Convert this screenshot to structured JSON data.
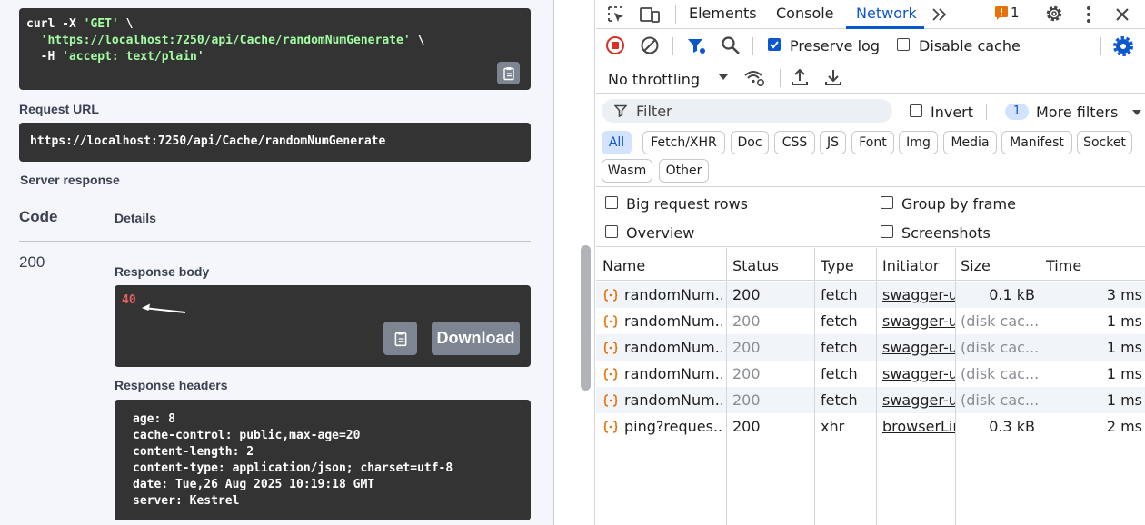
{
  "swagger": {
    "curl_lines": [
      "curl -X ",
      "'GET'",
      " \\",
      "  ",
      "'https://localhost:7250/api/Cache/randomNumGenerate'",
      " \\",
      "  -H ",
      "'accept: text/plain'"
    ],
    "request_url_label": "Request URL",
    "request_url": "https://localhost:7250/api/Cache/randomNumGenerate",
    "server_response_label": "Server response",
    "col_code": "Code",
    "col_details": "Details",
    "status_code": "200",
    "response_body_label": "Response body",
    "response_body_value": "40",
    "download_label": "Download",
    "response_headers_label": "Response headers",
    "response_headers": [
      "age: 8",
      "cache-control: public,max-age=20",
      "content-length: 2",
      "content-type: application/json; charset=utf-8",
      "date: Tue,26 Aug 2025 10:19:18 GMT",
      "server: Kestrel"
    ]
  },
  "devtools": {
    "tabs": {
      "elements": "Elements",
      "console": "Console",
      "network": "Network"
    },
    "issues_count": "1",
    "colors": {
      "accent": "#0b57d0",
      "record": "#d93025",
      "issue": "#e8710a"
    },
    "preserve_log": {
      "label": "Preserve log",
      "checked": true
    },
    "disable_cache": {
      "label": "Disable cache",
      "checked": false
    },
    "throttling": "No throttling",
    "filter_placeholder": "Filter",
    "invert": "Invert",
    "more_filters_count": "1",
    "more_filters": "More filters",
    "type_filters": [
      "All",
      "Fetch/XHR",
      "Doc",
      "CSS",
      "JS",
      "Font",
      "Img",
      "Media",
      "Manifest",
      "Socket",
      "Wasm",
      "Other"
    ],
    "options": {
      "big_request_rows": "Big request rows",
      "group_by_frame": "Group by frame",
      "overview": "Overview",
      "screenshots": "Screenshots"
    },
    "table": {
      "headers": [
        "Name",
        "Status",
        "Type",
        "Initiator",
        "Size",
        "Time"
      ],
      "rows": [
        {
          "name": "randomNum...",
          "status": "200",
          "type": "fetch",
          "initiator": "swagger-ui",
          "size": "0.1 kB",
          "time": "3 ms",
          "cached": false,
          "icon": "fetch-icon"
        },
        {
          "name": "randomNum...",
          "status": "200",
          "type": "fetch",
          "initiator": "swagger-ui",
          "size": "(disk cac...",
          "time": "1 ms",
          "cached": true,
          "icon": "fetch-icon"
        },
        {
          "name": "randomNum...",
          "status": "200",
          "type": "fetch",
          "initiator": "swagger-ui",
          "size": "(disk cac...",
          "time": "1 ms",
          "cached": true,
          "icon": "fetch-icon"
        },
        {
          "name": "randomNum...",
          "status": "200",
          "type": "fetch",
          "initiator": "swagger-ui",
          "size": "(disk cac...",
          "time": "1 ms",
          "cached": true,
          "icon": "fetch-icon"
        },
        {
          "name": "randomNum...",
          "status": "200",
          "type": "fetch",
          "initiator": "swagger-ui",
          "size": "(disk cac...",
          "time": "1 ms",
          "cached": true,
          "icon": "fetch-icon"
        },
        {
          "name": "ping?reques...",
          "status": "200",
          "type": "xhr",
          "initiator": "browserLin",
          "size": "0.3 kB",
          "time": "2 ms",
          "cached": false,
          "icon": "xhr-icon"
        }
      ]
    }
  }
}
